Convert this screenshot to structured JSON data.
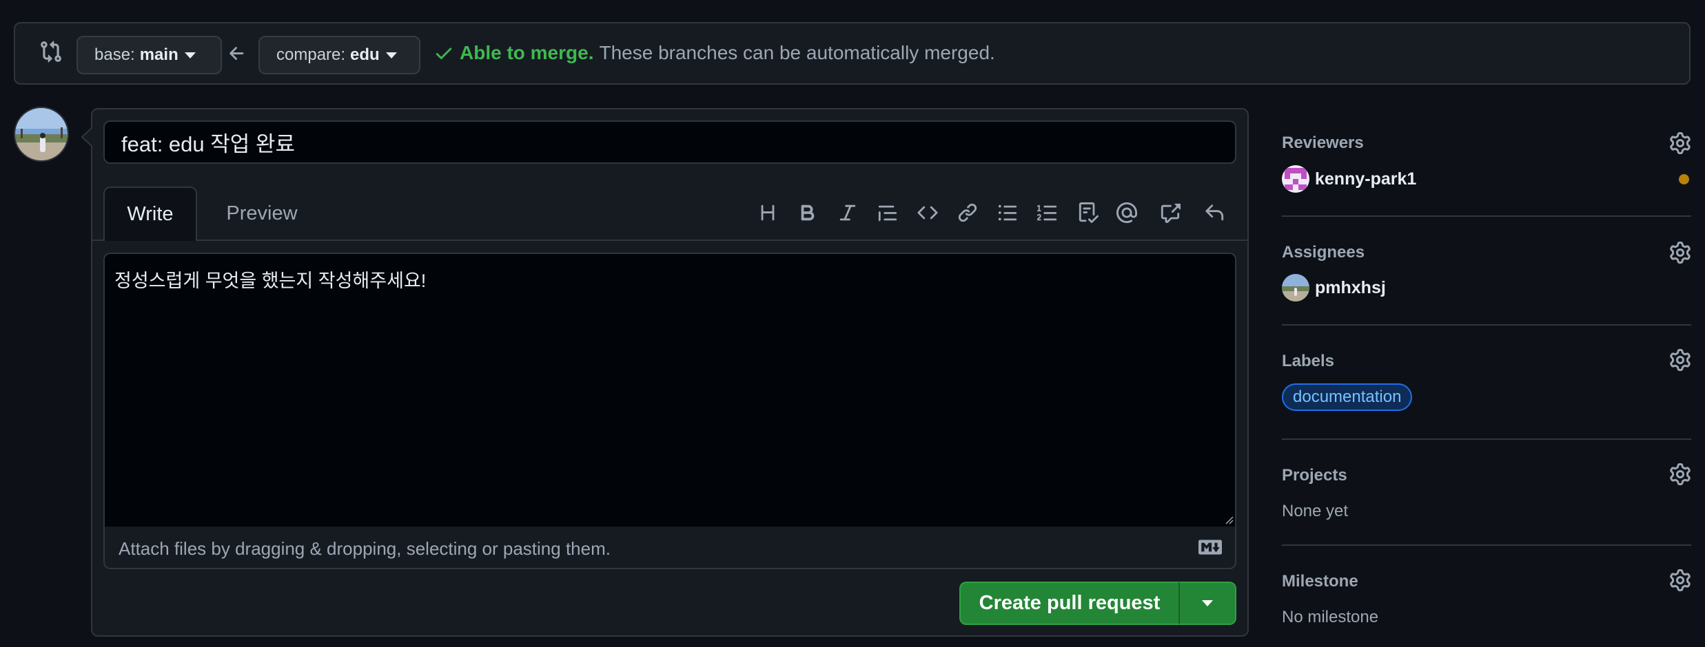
{
  "compare": {
    "base_prefix": "base:",
    "base_branch": "main",
    "compare_prefix": "compare:",
    "compare_branch": "edu",
    "merge_ok": "Able to merge.",
    "merge_text": "These branches can be automatically merged."
  },
  "editor": {
    "title_value": "feat: edu 작업 완료",
    "tab_write": "Write",
    "tab_preview": "Preview",
    "body_value": "정성스럽게 무엇을 했는지 작성해주세요!",
    "attach_hint": "Attach files by dragging & dropping, selecting or pasting them.",
    "toolbar_icons": [
      "heading-icon",
      "bold-icon",
      "italic-icon",
      "quote-icon",
      "code-icon",
      "link-icon",
      "unordered-list-icon",
      "ordered-list-icon",
      "task-list-icon",
      "mention-icon",
      "cross-reference-icon",
      "undo-icon"
    ]
  },
  "actions": {
    "create_label": "Create pull request"
  },
  "sidebar": {
    "reviewers_heading": "Reviewers",
    "reviewer_name": "kenny-park1",
    "assignees_heading": "Assignees",
    "assignee_name": "pmhxhsj",
    "labels_heading": "Labels",
    "label_name": "documentation",
    "projects_heading": "Projects",
    "projects_value": "None yet",
    "milestone_heading": "Milestone",
    "milestone_value": "No milestone"
  },
  "colors": {
    "background": "#0d1117",
    "success": "#3fb950",
    "primary_button": "#238636",
    "label_text": "#79c0ff",
    "pending": "#bb8009"
  }
}
